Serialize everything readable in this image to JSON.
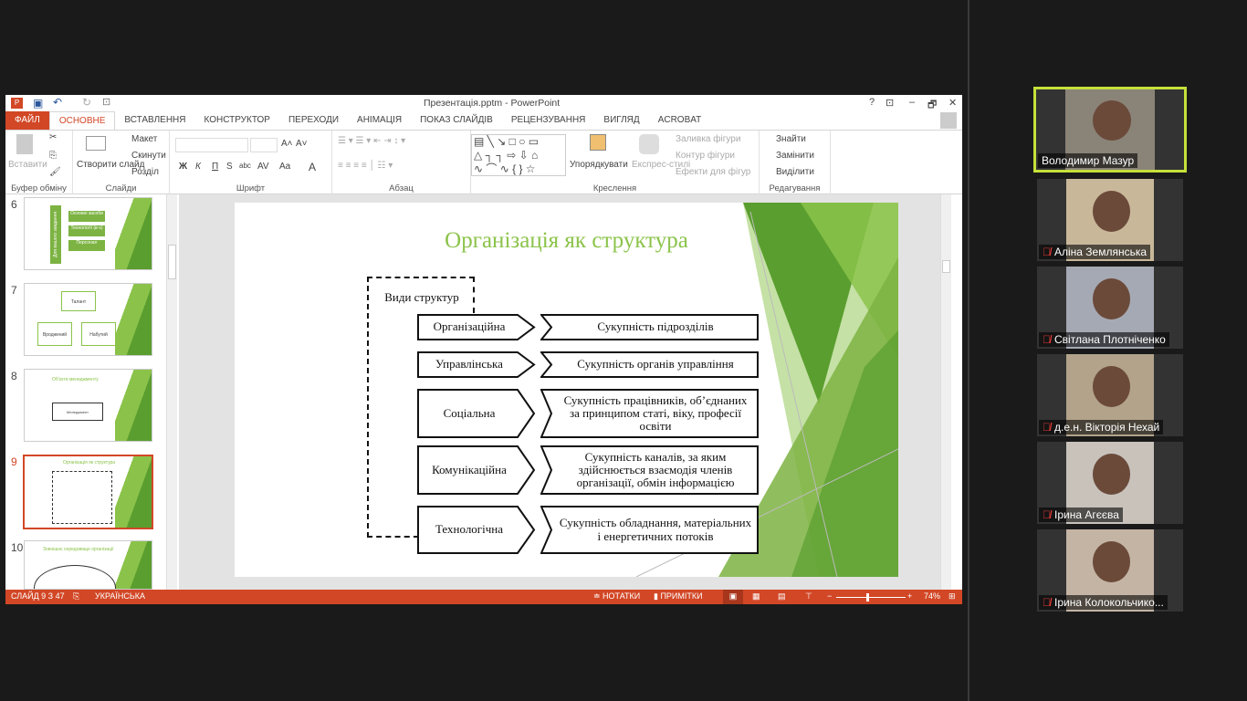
{
  "window": {
    "title": "Презентація.pptm - PowerPoint",
    "help": "?",
    "restore_ribbon": "⊡",
    "minimize": "–",
    "maximize": "🗗",
    "close": "✕"
  },
  "tabs": [
    "ФАЙЛ",
    "ОСНОВНЕ",
    "ВСТАВЛЕННЯ",
    "КОНСТРУКТОР",
    "ПЕРЕХОДИ",
    "АНІМАЦІЯ",
    "ПОКАЗ СЛАЙДІВ",
    "РЕЦЕНЗУВАННЯ",
    "ВИГЛЯД",
    "ACROBAT"
  ],
  "ribbon": {
    "clipboard": {
      "label": "Буфер обміну",
      "paste": "Вставити"
    },
    "slides": {
      "label": "Слайди",
      "new_slide": "Створити слайд",
      "layout": "Макет",
      "reset": "Скинути",
      "section": "Розділ"
    },
    "font": {
      "label": "Шрифт",
      "bold": "Ж",
      "italic": "К",
      "underline": "П",
      "strike": "S",
      "abc": "abc",
      "spacing": "AV",
      "case": "Aa",
      "color": "A",
      "grow": "A˄",
      "shrink": "A˅"
    },
    "paragraph": {
      "label": "Абзац"
    },
    "drawing": {
      "label": "Креслення",
      "arrange": "Упорядкувати",
      "quick_styles": "Експрес-стилі",
      "fill": "Заливка фігури",
      "outline": "Контур фігури",
      "effects": "Ефекти для фігур"
    },
    "editing": {
      "label": "Редагування",
      "find": "Знайти",
      "replace": "Замінити",
      "select": "Виділити"
    }
  },
  "thumbnails": [
    {
      "num": "6",
      "items": [
        "Основні засоби",
        "Технології (в-х)",
        "Персонал"
      ],
      "side": "Для вашого завдання"
    },
    {
      "num": "7",
      "items": [
        "Талант",
        "Вроджений",
        "Набутий"
      ]
    },
    {
      "num": "8",
      "title": "Об'єкти менеджменту",
      "center": "Менеджмент"
    },
    {
      "num": "9",
      "title": "Організація як структура"
    },
    {
      "num": "10",
      "title": "Зовнішнє середовище організації"
    }
  ],
  "slide": {
    "title": "Організація як структура",
    "group": "Види структур",
    "rows": [
      {
        "type": "Організаційна",
        "desc": "Сукупність підрозділів"
      },
      {
        "type": "Управлінська",
        "desc": "Сукупність органів управління"
      },
      {
        "type": "Соціальна",
        "desc": "Сукупність працівників, об’єднаних за принципом статі, віку, професії освіти"
      },
      {
        "type": "Комунікаційна",
        "desc": "Сукупність каналів, за яким здійснюється взаємодія членів організації, обмін інформацією"
      },
      {
        "type": "Технологічна",
        "desc": "Сукупність обладнання, матеріальних і енергетичних потоків"
      }
    ]
  },
  "status": {
    "slide": "СЛАЙД 9 З 47",
    "language": "УКРАЇНСЬКА",
    "notes": "НОТАТКИ",
    "comments": "ПРИМІТКИ",
    "zoom": "74%",
    "zoom_percent": 74
  },
  "participants": [
    {
      "name": "Володимир Мазур",
      "muted": false,
      "active": true,
      "bg": "#8a8378"
    },
    {
      "name": "Аліна Землянська",
      "muted": true,
      "bg": "#c9b79a"
    },
    {
      "name": "Світлана Плотніченко",
      "muted": true,
      "bg": "#a5a9b3"
    },
    {
      "name": "д.е.н. Вікторія Нехай",
      "muted": true,
      "bg": "#b2a38a"
    },
    {
      "name": "Ірина Агєєва",
      "muted": true,
      "bg": "#c8c2bb"
    },
    {
      "name": "Ірина Колокольчико...",
      "muted": true,
      "bg": "#c4b4a4"
    }
  ],
  "colors": {
    "accent": "#d24726",
    "slide_green": "#8bc34a",
    "active_speaker": "#c6e03a"
  }
}
